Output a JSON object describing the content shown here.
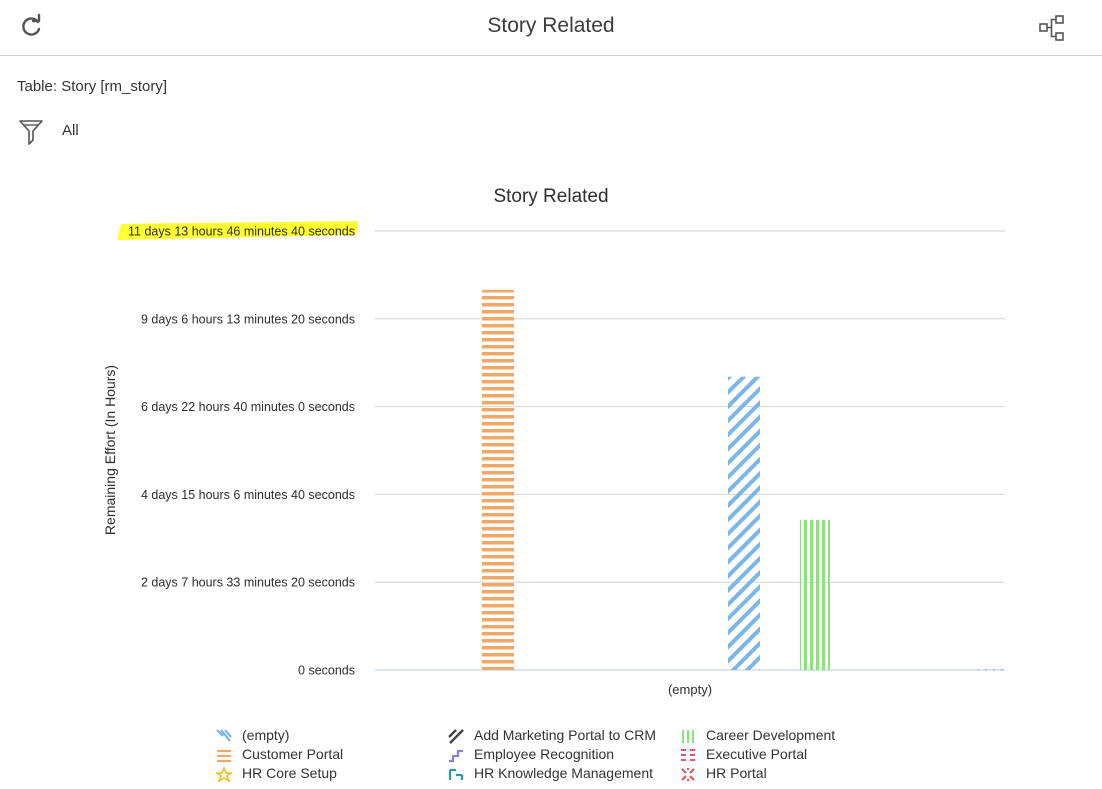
{
  "header": {
    "title": "Story Related"
  },
  "table_label": "Table: Story [rm_story]",
  "filter": {
    "label": "All"
  },
  "colors": {
    "orange": "#f0a868",
    "blue": "#7cb6e8",
    "green": "#8be27e",
    "grid": "#d6d6d6",
    "highlight": "#ffff33"
  },
  "legend": [
    {
      "label": "(empty)",
      "color": "#7cb6e8",
      "pattern": "diagonal"
    },
    {
      "label": "Add Marketing Portal to CRM",
      "color": "#444444",
      "pattern": "diagonal-reverse"
    },
    {
      "label": "Career Development",
      "color": "#8be27e",
      "pattern": "vertical"
    },
    {
      "label": "Customer Portal",
      "color": "#f0a868",
      "pattern": "horizontal"
    },
    {
      "label": "Employee Recognition",
      "color": "#8a7fd6",
      "pattern": "steps"
    },
    {
      "label": "Executive Portal",
      "color": "#e8506e",
      "pattern": "dashes"
    },
    {
      "label": "HR Core Setup",
      "color": "#e8c93a",
      "pattern": "star"
    },
    {
      "label": "HR Knowledge Management",
      "color": "#1f9ea0",
      "pattern": "corner"
    },
    {
      "label": "HR Portal",
      "color": "#e0505a",
      "pattern": "cross"
    }
  ],
  "chart_data": {
    "type": "bar",
    "title": "Story Related",
    "ylabel": "Remaining Effort (In Hours)",
    "xlabel": "",
    "categories": [
      "(empty)"
    ],
    "ylim": [
      0,
      1000000
    ],
    "yticks": [
      0,
      200000,
      400000,
      600000,
      800000,
      1000000
    ],
    "ytick_labels": [
      "0 seconds",
      "2 days 7 hours 33 minutes 20 seconds",
      "4 days 15 hours 6 minutes 40 seconds",
      "6 days 22 hours 40 minutes 0 seconds",
      "9 days 6 hours 13 minutes 20 seconds",
      "11 days 13 hours 46 minutes 40 seconds"
    ],
    "highlighted_tick": 5,
    "grid": true,
    "legend_position": "bottom",
    "series": [
      {
        "name": "Customer Portal",
        "values": [
          866000
        ],
        "color": "#f0a868",
        "pattern": "horizontal"
      },
      {
        "name": "(empty)",
        "values": [
          668000
        ],
        "color": "#7cb6e8",
        "pattern": "diagonal"
      },
      {
        "name": "Career Development",
        "values": [
          342000
        ],
        "color": "#8be27e",
        "pattern": "vertical"
      },
      {
        "name": "",
        "values": [
          4000
        ],
        "color": "#7cb6e8",
        "pattern": "dots"
      }
    ]
  }
}
